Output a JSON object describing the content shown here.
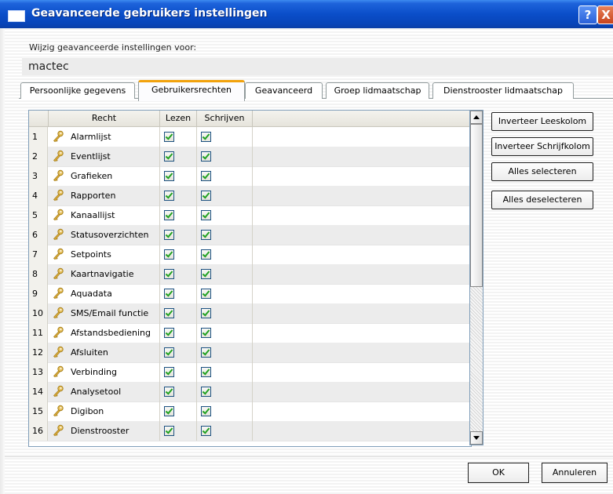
{
  "window": {
    "title": "Geavanceerde gebruikers instellingen",
    "help_glyph": "?",
    "close_glyph": "X"
  },
  "user_section": {
    "label": "Wijzig geavanceerde instellingen voor:",
    "username": "mactec"
  },
  "tabs": [
    {
      "label": "Persoonlijke gegevens",
      "active": false
    },
    {
      "label": "Gebruikersrechten",
      "active": true
    },
    {
      "label": "Geavanceerd",
      "active": false
    },
    {
      "label": "Groep lidmaatschap",
      "active": false
    },
    {
      "label": "Dienstrooster lidmaatschap",
      "active": false
    }
  ],
  "grid": {
    "columns": [
      "Recht",
      "Lezen",
      "Schrijven"
    ],
    "rows": [
      {
        "num": "1",
        "name": "Alarmlijst",
        "read": true,
        "write": true
      },
      {
        "num": "2",
        "name": "Eventlijst",
        "read": true,
        "write": true
      },
      {
        "num": "3",
        "name": "Grafieken",
        "read": true,
        "write": true
      },
      {
        "num": "4",
        "name": "Rapporten",
        "read": true,
        "write": true
      },
      {
        "num": "5",
        "name": "Kanaallijst",
        "read": true,
        "write": true
      },
      {
        "num": "6",
        "name": "Statusoverzichten",
        "read": true,
        "write": true
      },
      {
        "num": "7",
        "name": "Setpoints",
        "read": true,
        "write": true
      },
      {
        "num": "8",
        "name": "Kaartnavigatie",
        "read": true,
        "write": true
      },
      {
        "num": "9",
        "name": "Aquadata",
        "read": true,
        "write": true
      },
      {
        "num": "10",
        "name": "SMS/Email functie",
        "read": true,
        "write": true
      },
      {
        "num": "11",
        "name": "Afstandsbediening",
        "read": true,
        "write": true
      },
      {
        "num": "12",
        "name": "Afsluiten",
        "read": true,
        "write": true
      },
      {
        "num": "13",
        "name": "Verbinding",
        "read": true,
        "write": true
      },
      {
        "num": "14",
        "name": "Analysetool",
        "read": true,
        "write": true
      },
      {
        "num": "15",
        "name": "Digibon",
        "read": true,
        "write": true
      },
      {
        "num": "16",
        "name": "Dienstrooster",
        "read": true,
        "write": true
      }
    ]
  },
  "side_buttons": [
    "Inverteer Leeskolom",
    "Inverteer Schrijfkolom",
    "Alles selecteren",
    "Alles deselecteren"
  ],
  "footer": {
    "ok_label": "OK",
    "cancel_label": "Annuleren"
  },
  "colors": {
    "titlebar": "#0a4ec9",
    "active_tab_accent": "#f2a20c",
    "checkmark": "#21a121"
  },
  "icons": {
    "row_icon": "key-icon"
  }
}
